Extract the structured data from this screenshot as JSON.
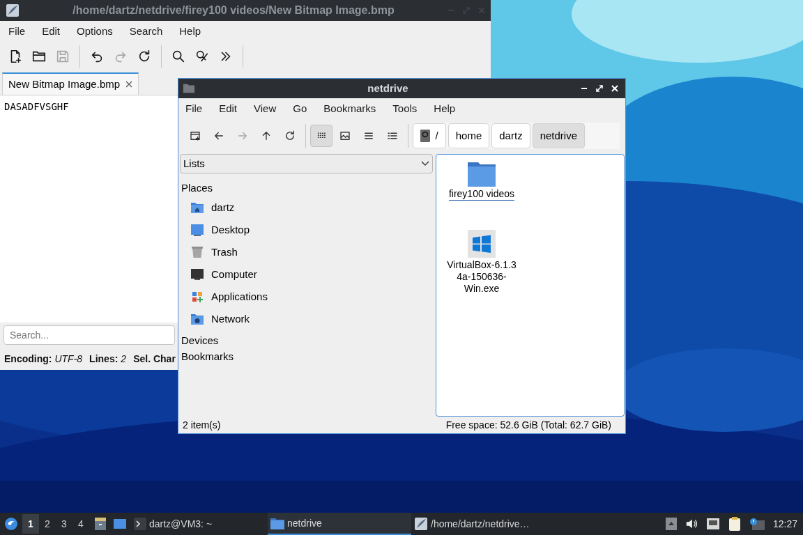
{
  "editor": {
    "title": "/home/dartz/netdrive/firey100 videos/New Bitmap Image.bmp",
    "menu": [
      "File",
      "Edit",
      "Options",
      "Search",
      "Help"
    ],
    "toolbar": [
      {
        "kind": "new",
        "disabled": false
      },
      {
        "kind": "open",
        "disabled": false
      },
      {
        "kind": "save",
        "disabled": true
      },
      {
        "kind": "separator"
      },
      {
        "kind": "undo",
        "disabled": false
      },
      {
        "kind": "redo",
        "disabled": true
      },
      {
        "kind": "reload",
        "disabled": false
      },
      {
        "kind": "separator"
      },
      {
        "kind": "find",
        "disabled": false
      },
      {
        "kind": "replace",
        "disabled": false
      },
      {
        "kind": "more",
        "disabled": false
      },
      {
        "kind": "separator"
      }
    ],
    "tabs": [
      {
        "label": "New Bitmap Image.bmp",
        "selected": true
      }
    ],
    "text_lines": [
      "DASADFVSGHF"
    ],
    "search": {
      "placeholder": "Search..."
    },
    "status": [
      {
        "label": "Encoding:",
        "value": "UTF-8"
      },
      {
        "label": "Lines:",
        "value": "2"
      },
      {
        "label": "Sel. Char"
      }
    ]
  },
  "file_manager": {
    "title": "netdrive",
    "menu": [
      "File",
      "Edit",
      "View",
      "Go",
      "Bookmarks",
      "Tools",
      "Help"
    ],
    "toolbar": [
      {
        "kind": "newtab",
        "disabled": false,
        "selected": false
      },
      {
        "kind": "back",
        "disabled": false,
        "selected": false
      },
      {
        "kind": "forward",
        "disabled": true,
        "selected": false
      },
      {
        "kind": "up",
        "disabled": false,
        "selected": false
      },
      {
        "kind": "reload",
        "disabled": false,
        "selected": false
      },
      {
        "kind": "separator"
      },
      {
        "kind": "iconview",
        "disabled": false,
        "selected": true
      },
      {
        "kind": "thumbnail",
        "disabled": false,
        "selected": false
      },
      {
        "kind": "compact",
        "disabled": false,
        "selected": false
      },
      {
        "kind": "detailed",
        "disabled": false,
        "selected": false
      }
    ],
    "path": [
      {
        "label": "/",
        "kind": "root",
        "selected": false
      },
      {
        "label": "home",
        "kind": "dir",
        "selected": false
      },
      {
        "label": "dartz",
        "kind": "dir",
        "selected": false
      },
      {
        "label": "netdrive",
        "kind": "dir",
        "selected": true
      }
    ],
    "side_pane_mode": "Lists",
    "sidebar": [
      {
        "label": "Places",
        "items": [
          {
            "label": "dartz",
            "kind": "home"
          },
          {
            "label": "Desktop",
            "kind": "desktop"
          },
          {
            "label": "Trash",
            "kind": "trash"
          },
          {
            "label": "Computer",
            "kind": "computer"
          },
          {
            "label": "Applications",
            "kind": "applications"
          },
          {
            "label": "Network",
            "kind": "network"
          }
        ]
      },
      {
        "label": "Devices"
      },
      {
        "label": "Bookmarks"
      }
    ],
    "files": [
      {
        "name": "firey100 videos",
        "kind": "folder",
        "selected": true
      },
      {
        "lines": [
          "VirtualBox-6.1.3",
          "4a-150636-",
          "Win.exe"
        ],
        "kind": "exe",
        "selected": false
      }
    ],
    "status_left": "2 item(s)",
    "status_right": "Free space: 52.6 GiB (Total: 62.7 GiB)"
  },
  "taskbar": {
    "workspaces": [
      {
        "label": "1",
        "selected": true
      },
      {
        "label": "2",
        "selected": false
      },
      {
        "label": "3",
        "selected": false
      },
      {
        "label": "4",
        "selected": false
      }
    ],
    "tasks": [
      {
        "label": "dartz@VM3: ~",
        "kind": "terminal",
        "selected": false
      },
      {
        "label": "netdrive",
        "kind": "folder",
        "selected": true
      },
      {
        "label": "/home/dartz/netdrive…",
        "kind": "editor",
        "selected": false
      }
    ],
    "clock": "12:27"
  }
}
